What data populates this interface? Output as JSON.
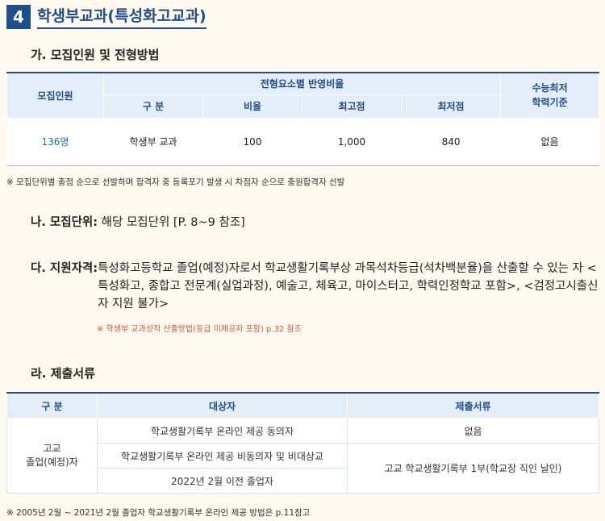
{
  "section": {
    "number": "4",
    "title": "학생부교과(특성화고교과)"
  },
  "a": {
    "title": "가. 모집인원 및 전형방법",
    "table": {
      "col_quota": "모집인원",
      "col_group": "전형요소별 반영비율",
      "col_min": "수능최저\n학력기준",
      "sub_headers": [
        "구 분",
        "비율",
        "최고점",
        "최저점"
      ],
      "row": {
        "quota": "136명",
        "type": "학생부 교과",
        "ratio": "100",
        "max": "1,000",
        "min": "840",
        "criteria": "없음"
      }
    },
    "note": "※ 모집단위별 총점 순으로 선발하며 합격자 중 등록포기 발생 시 차점자 순으로 충원합격자 선발"
  },
  "b": {
    "label": "나. 모집단위:",
    "text": " 해당 모집단위 [P. 8~9 참조]"
  },
  "c": {
    "label": "다. 지원자격:",
    "text": " 특성화고등학교 졸업(예정)자로서 학교생활기록부상 과목석차등급(석차백분율)을 산출할 수 있는 자 <특성화고, 종합고 전문계(실업과정), 예술고, 체육고, 마이스터고, 학력인정학교 포함>, <검정고시출신자 지원 불가>",
    "note": "※ 학생부 교과성적 산출방법(등급 미제공자 포함) p.32 참조"
  },
  "d": {
    "title": "라. 제출서류",
    "table": {
      "headers": [
        "구 분",
        "대상자",
        "제출서류"
      ],
      "group": "고교\n졸업(예정)자",
      "rows": [
        {
          "target": "학교생활기록부 온라인 제공 동의자",
          "docs": "없음"
        },
        {
          "target": "학교생활기록부 온라인 제공 비동의자 및 비대상교",
          "docs": "고교 학교생활기록부 1부(학교장 직인 날인)"
        },
        {
          "target": "2022년 2월 이전 졸업자"
        }
      ]
    },
    "note": "※ 2005년 2월 ~ 2021년 2월 졸업자 학교생활기록부 온라인 제공 방법은 p.11참고"
  }
}
